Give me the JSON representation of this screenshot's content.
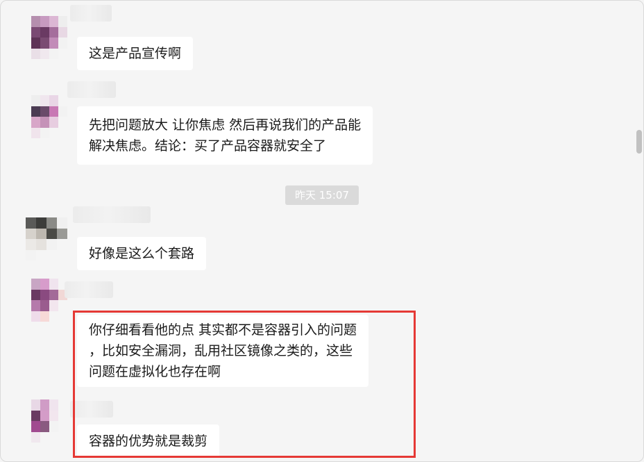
{
  "messages": [
    {
      "lines": [
        "这是产品宣传啊"
      ]
    },
    {
      "lines": [
        "先把问题放大 让你焦虑 然后再说我们的产品能",
        "解决焦虑。结论：买了产品容器就安全了"
      ]
    },
    {
      "lines": [
        "好像是这么个套路"
      ]
    },
    {
      "lines": [
        "你仔细看看他的点 其实都不是容器引入的问题",
        "，比如安全漏洞，乱用社区镜像之类的，这些",
        "问题在虚拟化也存在啊"
      ]
    },
    {
      "lines": [
        "容器的优势就是裁剪"
      ]
    }
  ],
  "timestamp": "昨天 15:07",
  "colors": {
    "highlight": "#e53935",
    "bubble": "#ffffff",
    "background": "#f5f5f5"
  }
}
